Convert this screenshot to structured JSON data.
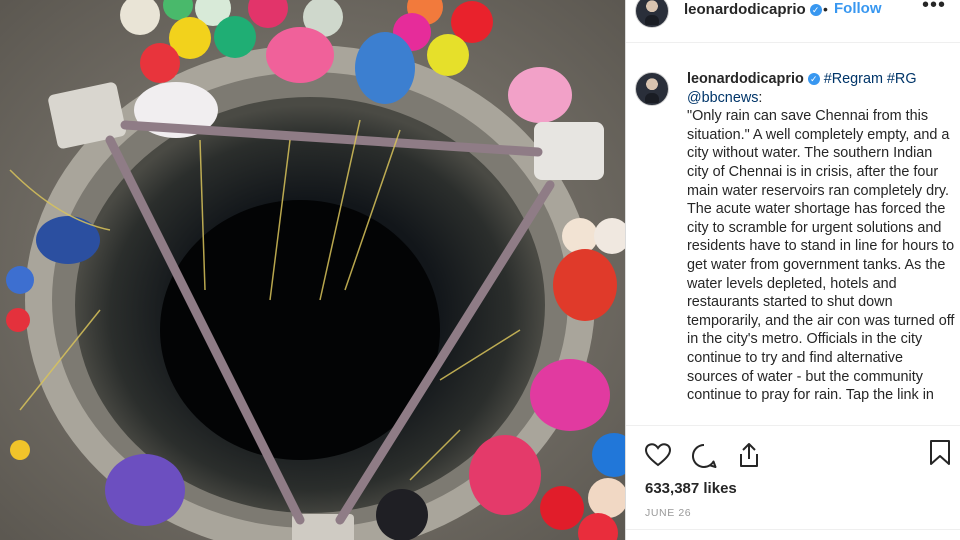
{
  "post": {
    "photo_alt": "Overhead view of a large empty well with people drawing water with ropes and colorful water pots",
    "header": {
      "username": "leonardodicaprio",
      "verified_icon": "verified-badge-icon",
      "separator": "•",
      "follow_label": "Follow",
      "more_label": "•••"
    },
    "caption": {
      "username": "leonardodicaprio",
      "hashtags": "#Regram #RG",
      "mention": "@bbcnews",
      "text": ":\n\"Only rain can save Chennai from this situation.\" A well completely empty, and a city without water. The southern Indian city of Chennai is in crisis, after the four main water reservoirs ran completely dry. The acute water shortage has forced the city to scramble for urgent solutions and residents have to stand in line for hours to get water from government tanks. As the water levels depleted, hotels and restaurants started to shut down temporarily, and the air con was turned off in the city's metro. Officials in the city continue to try and find alternative sources of water - but the community continue to pray for rain. Tap the link in"
    },
    "actions": {
      "like_icon": "heart-icon",
      "comment_icon": "comment-icon",
      "share_icon": "share-icon",
      "save_icon": "bookmark-icon"
    },
    "likes_text": "633,387 likes",
    "date_text": "JUNE 26"
  },
  "colors": {
    "link_blue": "#3897f0",
    "tag_blue": "#003569",
    "text": "#262626",
    "muted": "#999999",
    "border": "#efefef"
  }
}
